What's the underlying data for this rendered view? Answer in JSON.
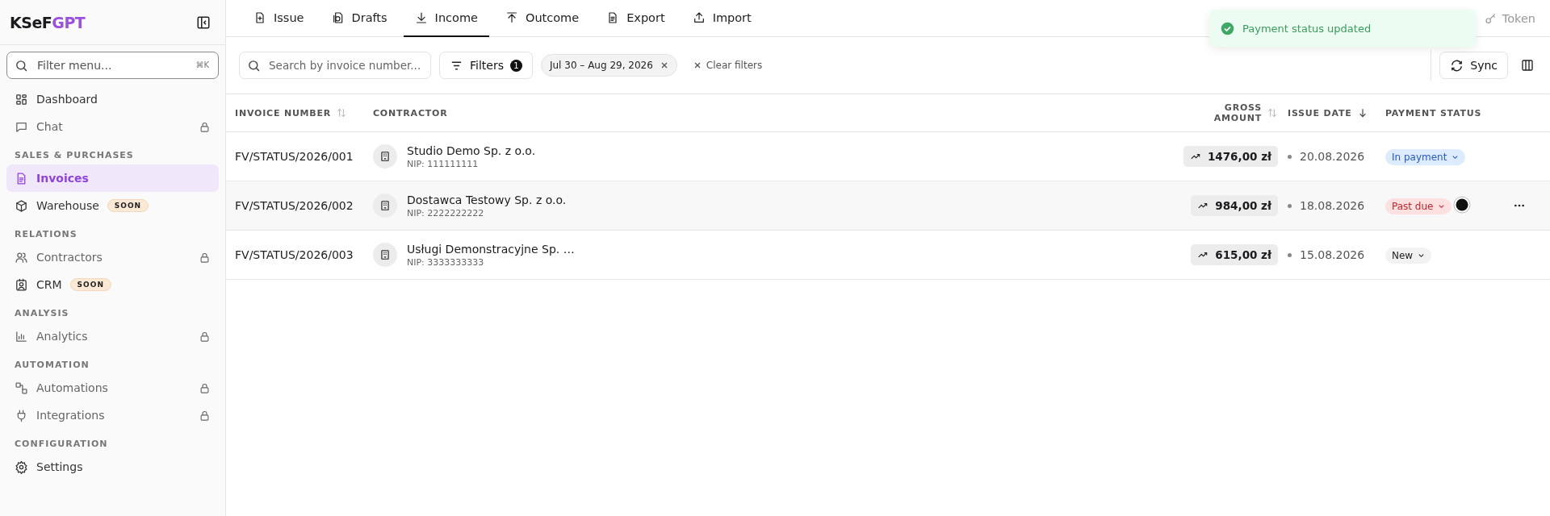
{
  "sidebar": {
    "logo": {
      "main": "KSeF",
      "accent": "GPT"
    },
    "filter": {
      "placeholder": "Filter menu...",
      "shortcut": "⌘K"
    },
    "sections": [
      {
        "items": [
          {
            "label": "Dashboard",
            "selected": false,
            "locked": false
          },
          {
            "label": "Chat",
            "selected": false,
            "locked": true
          }
        ]
      },
      {
        "title": "SALES & PURCHASES",
        "items": [
          {
            "label": "Invoices",
            "selected": true,
            "locked": false
          },
          {
            "label": "Warehouse",
            "selected": false,
            "locked": false,
            "badge": "SOON"
          }
        ]
      },
      {
        "title": "RELATIONS",
        "items": [
          {
            "label": "Contractors",
            "selected": false,
            "locked": true
          },
          {
            "label": "CRM",
            "selected": false,
            "locked": false,
            "badge": "SOON"
          }
        ]
      },
      {
        "title": "ANALYSIS",
        "items": [
          {
            "label": "Analytics",
            "selected": false,
            "locked": true
          }
        ]
      },
      {
        "title": "AUTOMATION",
        "items": [
          {
            "label": "Automations",
            "selected": false,
            "locked": true
          },
          {
            "label": "Integrations",
            "selected": false,
            "locked": true
          }
        ]
      },
      {
        "title": "CONFIGURATION",
        "items": [
          {
            "label": "Settings",
            "selected": false,
            "locked": false
          }
        ]
      }
    ]
  },
  "tabs": [
    {
      "label": "Issue",
      "selected": false
    },
    {
      "label": "Drafts",
      "selected": false
    },
    {
      "label": "Income",
      "selected": true
    },
    {
      "label": "Outcome",
      "selected": false
    },
    {
      "label": "Export",
      "selected": false
    },
    {
      "label": "Import",
      "selected": false
    }
  ],
  "token_button": "Token",
  "toast": {
    "message": "Payment status updated"
  },
  "toolbar": {
    "search": {
      "placeholder": "Search by invoice number..."
    },
    "filters": {
      "label": "Filters",
      "count": "1"
    },
    "chip": "Jul 30 – Aug 29, 2026",
    "clear": "Clear filters",
    "sync": "Sync"
  },
  "table": {
    "columns": [
      "INVOICE NUMBER",
      "CONTRACTOR",
      "GROSS AMOUNT",
      "ISSUE DATE",
      "PAYMENT STATUS"
    ],
    "rows": [
      {
        "number": "FV/STATUS/2026/001",
        "contractor": "Studio Demo Sp. z o.o.",
        "nip": "NIP: 111111111",
        "amount": "1476,00 zł",
        "date": "20.08.2026",
        "status": {
          "label": "In payment",
          "kind": "in_payment"
        },
        "hovered": false
      },
      {
        "number": "FV/STATUS/2026/002",
        "contractor": "Dostawca Testowy Sp. z o.o.",
        "nip": "NIP: 2222222222",
        "amount": "984,00 zł",
        "date": "18.08.2026",
        "status": {
          "label": "Past due",
          "kind": "past_due"
        },
        "hovered": true
      },
      {
        "number": "FV/STATUS/2026/003",
        "contractor": "Usługi Demonstracyjne Sp. …",
        "nip": "NIP: 3333333333",
        "amount": "615,00 zł",
        "date": "15.08.2026",
        "status": {
          "label": "New",
          "kind": "new"
        },
        "hovered": false
      }
    ]
  }
}
